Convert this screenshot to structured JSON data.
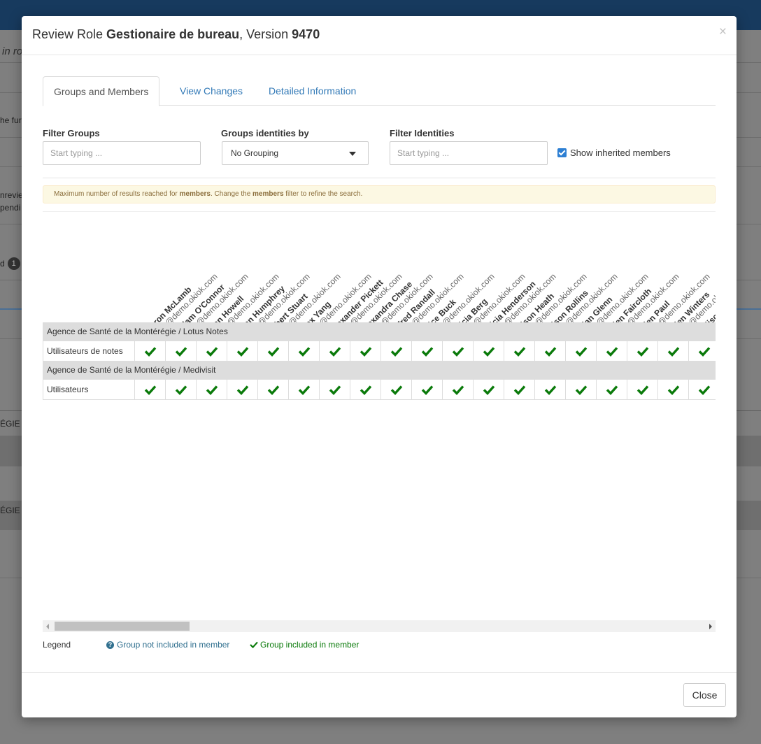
{
  "background": {
    "italic_text": "in ro",
    "row_texts": [
      "he fur",
      "nrevie",
      "pendi",
      "d",
      "ÉGIE",
      "ÉGIE"
    ],
    "badge": "1"
  },
  "modal": {
    "title_prefix": "Review Role ",
    "role_name": "Gestionaire de bureau",
    "title_mid": ", Version ",
    "version": "9470",
    "close_x": "×"
  },
  "tabs": [
    {
      "label": "Groups and Members",
      "active": true
    },
    {
      "label": "View Changes",
      "active": false
    },
    {
      "label": "Detailed Information",
      "active": false
    }
  ],
  "filters": {
    "filter_groups_label": "Filter Groups",
    "filter_groups_placeholder": "Start typing ...",
    "groups_identities_label": "Groups identities by",
    "grouping_value": "No Grouping",
    "filter_identities_label": "Filter Identities",
    "filter_identities_placeholder": "Start typing ...",
    "show_inherited_label": "Show inherited members",
    "show_inherited_checked": true
  },
  "alert": {
    "p1": "Maximum number of results reached for ",
    "b1": "members",
    "p2": ". Change the ",
    "b2": "members",
    "p3": " filter to refine the search."
  },
  "members": [
    {
      "name": "Aaron McLamb",
      "email": "racm@demo.okiok.com"
    },
    {
      "name": "Adam O'Connor",
      "email": "racm@demo.okiok.com"
    },
    {
      "name": "Alan Howell",
      "email": "racm@demo.okiok.com"
    },
    {
      "name": "Alan Humphrey",
      "email": "racm@demo.okiok.com"
    },
    {
      "name": "Albert Stuart",
      "email": "racm@demo.okiok.com"
    },
    {
      "name": "Alex Yang",
      "email": "racm@demo.okiok.com"
    },
    {
      "name": "Alexander Pickett",
      "email": "racm@demo.okiok.com"
    },
    {
      "name": "Alexandra Chase",
      "email": "racm@demo.okiok.com"
    },
    {
      "name": "Alfred Randall",
      "email": "racm@demo.okiok.com"
    },
    {
      "name": "Alice Buck",
      "email": "racm@demo.okiok.com"
    },
    {
      "name": "Alicia Berg",
      "email": "racm@demo.okiok.com"
    },
    {
      "name": "Alicia Henderson",
      "email": "racm@demo.okiok.com"
    },
    {
      "name": "Alison Heath",
      "email": "racm@demo.okiok.com"
    },
    {
      "name": "Alison Rollins",
      "email": "racm@demo.okiok.com"
    },
    {
      "name": "Allan Glenn",
      "email": "racm@demo.okiok.com"
    },
    {
      "name": "Allen Faircloth",
      "email": "racm@demo.okiok.com"
    },
    {
      "name": "Allen Paul",
      "email": "racm@demo.okiok.com"
    },
    {
      "name": "Allen Winters",
      "email": "racm@demo.okiok.com"
    },
    {
      "name": "Allison",
      "email": "racm@demo.okiok.com"
    }
  ],
  "groups": [
    {
      "title": "Agence de Santé de la Montérégie / Lotus Notes",
      "row_label": "Utilisateurs de notes",
      "included": true
    },
    {
      "title": "Agence de Santé de la Montérégie / Medivisit",
      "row_label": "Utilisateurs",
      "included": true
    }
  ],
  "legend": {
    "label": "Legend",
    "not_included": "Group not included in member",
    "included": "Group included in member"
  },
  "footer": {
    "close_label": "Close"
  },
  "colors": {
    "check_green": "#0a7a0a",
    "link_blue": "#337ab7",
    "info_blue": "#31708f",
    "header_bar": "#173a5e"
  }
}
